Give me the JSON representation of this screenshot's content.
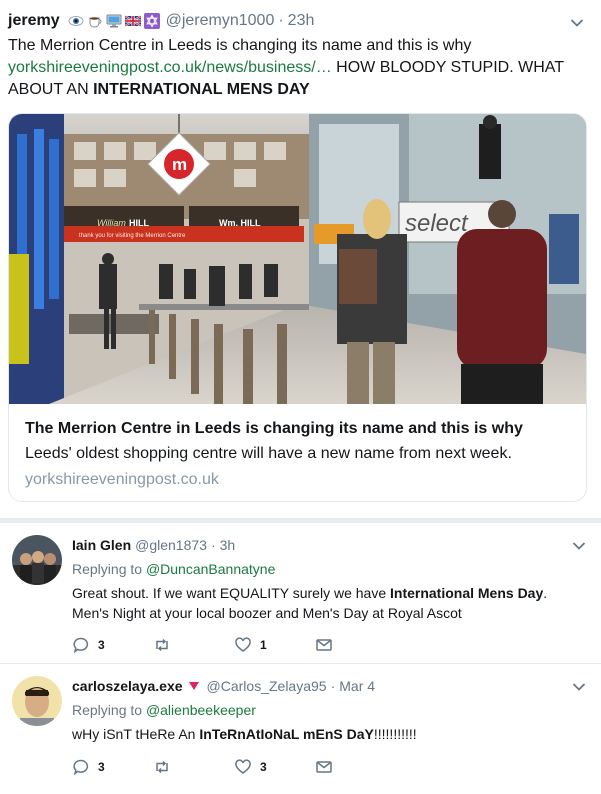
{
  "main_tweet": {
    "author_name": "jeremy",
    "emoji_icons": [
      "eye-icon",
      "coffee-icon",
      "computer-icon",
      "uk-flag-icon",
      "star-of-david-icon"
    ],
    "handle": "@jeremyn1000",
    "separator": "·",
    "time": "23h",
    "text_line1": "The Merrion Centre in Leeds is changing its name and this is why",
    "link": "yorkshireeveningpost.co.uk/news/business/…",
    "text_after_link": " HOW BLOODY STUPID. WHAT ABOUT AN ",
    "text_bold": "INTERNATIONAL MENS DAY",
    "card": {
      "title": "The Merrion Centre in Leeds is changing its name and this is why",
      "description": "Leeds' oldest shopping centre will have a new name from next week.",
      "domain": "yorkshireeveningpost.co.uk",
      "image_texts": {
        "sign_letter": "m",
        "shop_sign": "select",
        "store_name": "William HILL",
        "banner": "thank you for visiting the Merrion Centre"
      }
    }
  },
  "replies": [
    {
      "name": "Iain Glen",
      "handle": "@glen1873",
      "separator": "·",
      "time": "3h",
      "replying_label": "Replying to",
      "replying_to": "@DuncanBannatyne",
      "text_a": "Great shout. If we want EQUALITY surely we have ",
      "text_bold": "International Mens Day",
      "text_b": ". Men's Night at your local boozer and Men's Day at Royal Ascot",
      "reply_count": "3",
      "retweet_count": "",
      "like_count": "1"
    },
    {
      "name": "carloszelaya.exe",
      "handle": "@Carlos_Zelaya95",
      "separator": "·",
      "time": "Mar 4",
      "replying_label": "Replying to",
      "replying_to": "@alienbeekeeper",
      "text_a": "wHy iSnT tHeRe An ",
      "text_bold": "InTeRnAtIoNaL mEnS DaY",
      "text_b": "!!!!!!!!!!!",
      "reply_count": "3",
      "retweet_count": "",
      "like_count": "3"
    }
  ],
  "colors": {
    "link_green": "#1b7a3e",
    "secondary_text": "#657786",
    "border": "#e6ecf0",
    "red_badge": "#e0245e"
  }
}
